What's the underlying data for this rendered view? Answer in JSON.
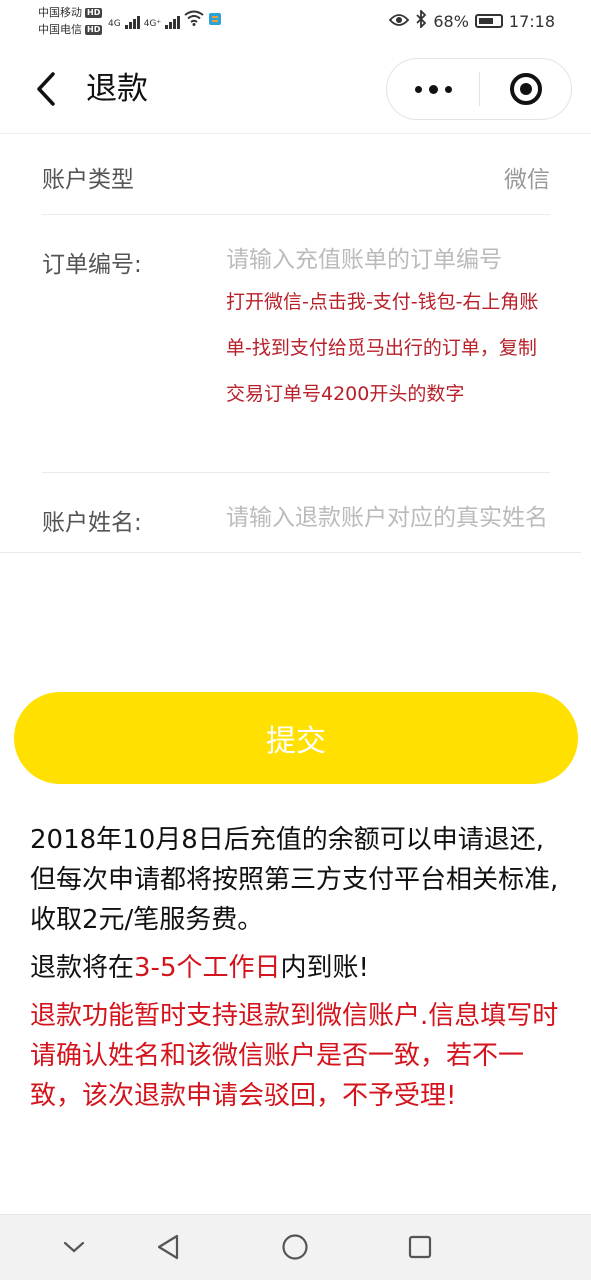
{
  "status_bar": {
    "carrier_1": "中国移动",
    "carrier_2": "中国电信",
    "hd_badge": "HD",
    "net_1": "4G",
    "net_2": "4G⁺",
    "battery": "68%",
    "time": "17:18"
  },
  "nav": {
    "title": "退款"
  },
  "form": {
    "account_type_label": "账户类型",
    "account_type_value": "微信",
    "order_label": "订单编号:",
    "order_placeholder": "请输入充值账单的订单编号",
    "order_hint": "打开微信-点击我-支付-钱包-右上角账单-找到支付给觅马出行的订单，复制交易订单号4200开头的数字",
    "name_label": "账户姓名:",
    "name_placeholder": "请输入退款账户对应的真实姓名"
  },
  "submit_label": "提交",
  "notes": {
    "p1": "2018年10月8日后充值的余额可以申请退还,但每次申请都将按照第三方支付平台相关标准,收取2元/笔服务费。",
    "p2_before": "退款将在",
    "p2_highlight": "3-5个工作日",
    "p2_after": "内到账!",
    "p3": "退款功能暂时支持退款到微信账户.信息填写时请确认姓名和该微信账户是否一致，若不一致，该次退款申请会驳回，不予受理!"
  },
  "colors": {
    "accent_yellow": "#ffe000",
    "warning_red": "#d4141c",
    "hint_red": "#b8202a"
  },
  "icons": {
    "back": "chevron-left-icon",
    "more": "more-dots-icon",
    "close": "target-ring-icon",
    "sys_down": "chevron-down-icon",
    "sys_back": "triangle-back-icon",
    "sys_home": "circle-home-icon",
    "sys_recent": "square-recent-icon"
  }
}
